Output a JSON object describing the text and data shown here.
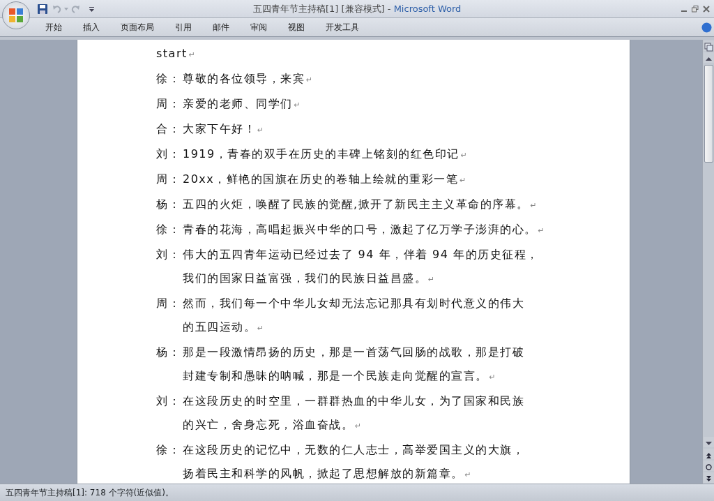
{
  "window": {
    "title": {
      "document": "五四青年节主持稿[1] [兼容模式]",
      "separator": "-",
      "app": "Microsoft Word"
    }
  },
  "quick_access": [
    {
      "kind": "save",
      "disabled": false
    },
    {
      "kind": "undo",
      "disabled": true
    },
    {
      "kind": "redo",
      "disabled": true
    }
  ],
  "ribbon_tabs": [
    "开始",
    "插入",
    "页面布局",
    "引用",
    "邮件",
    "审阅",
    "视图",
    "开发工具"
  ],
  "document": {
    "paragraphs": [
      {
        "lines": [
          "start"
        ],
        "end_mark": "↵"
      },
      {
        "speaker": "徐：",
        "lines": [
          "尊敬的各位领导，来宾"
        ],
        "end_mark": "↵"
      },
      {
        "speaker": "周：",
        "lines": [
          "亲爱的老师、同学们"
        ],
        "end_mark": "↵"
      },
      {
        "speaker": "合：",
        "lines": [
          "大家下午好！"
        ],
        "end_mark": "↵"
      },
      {
        "speaker": "刘：",
        "lines": [
          "1919，青春的双手在历史的丰碑上铭刻的红色印记"
        ],
        "end_mark": "↵"
      },
      {
        "speaker": "周：",
        "lines": [
          "20xx，鲜艳的国旗在历史的卷轴上绘就的重彩一笔"
        ],
        "end_mark": "↵"
      },
      {
        "speaker": "杨：",
        "lines": [
          "五四的火炬，唤醒了民族的觉醒,掀开了新民主主义革命的序幕。"
        ],
        "end_mark": "↵"
      },
      {
        "speaker": "徐：",
        "lines": [
          "青春的花海，高唱起振兴中华的口号，激起了亿万学子澎湃的心。"
        ],
        "end_mark": "↵"
      },
      {
        "speaker": "刘：",
        "lines": [
          "伟大的五四青年运动已经过去了 94 年，伴着 94 年的历史征程，",
          "我们的国家日益富强，我们的民族日益昌盛。"
        ],
        "end_mark": "↵"
      },
      {
        "speaker": "周：",
        "lines": [
          "然而，我们每一个中华儿女却无法忘记那具有划时代意义的伟大",
          "的五四运动。"
        ],
        "end_mark": "↵"
      },
      {
        "speaker": "杨：",
        "lines": [
          "那是一段激情昂扬的历史，那是一首荡气回肠的战歌，那是打破",
          "封建专制和愚昧的呐喊，那是一个民族走向觉醒的宣言。"
        ],
        "end_mark": "↵"
      },
      {
        "speaker": "刘：",
        "lines": [
          "在这段历史的时空里，一群群热血的中华儿女，为了国家和民族",
          "的兴亡，舍身忘死，浴血奋战。"
        ],
        "end_mark": "↵"
      },
      {
        "speaker": "徐：",
        "lines": [
          "在这段历史的记忆中，无数的仁人志士，高举爱国主义的大旗，",
          "扬着民主和科学的风帆，掀起了思想解放的新篇章。"
        ],
        "end_mark": "↵"
      }
    ]
  },
  "status_bar": {
    "text": "五四青年节主持稿[1]: 718 个字符(近似值)。"
  }
}
